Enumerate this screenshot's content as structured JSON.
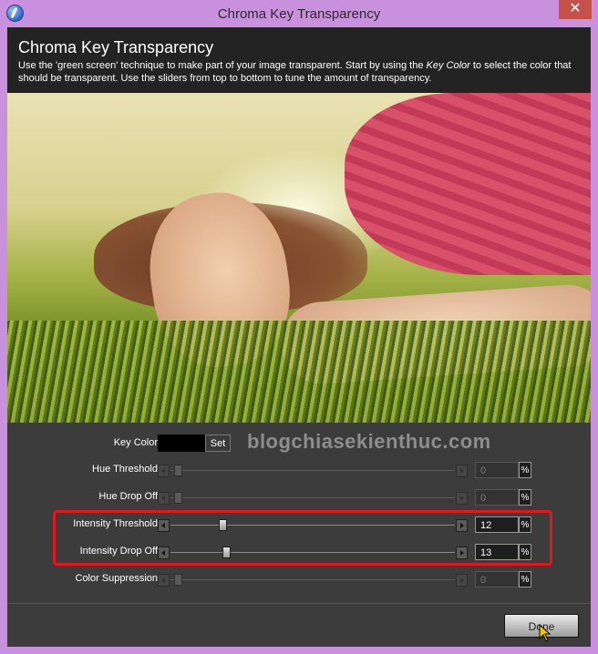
{
  "window": {
    "title": "Chroma Key Transparency",
    "close_glyph": "✕"
  },
  "header": {
    "title": "Chroma Key Transparency",
    "desc_before": "Use the 'green screen' technique to make part of your image transparent. Start by using the ",
    "desc_em": "Key Color",
    "desc_after": " to select the color that should be transparent. Use the sliders from top to bottom to tune the amount of transparency."
  },
  "controls": {
    "key_color": {
      "label": "Key Color",
      "set_label": "Set",
      "swatch_color": "#000000"
    },
    "sliders": [
      {
        "label": "Hue Threshold",
        "value": "0",
        "unit": "%",
        "level": 0,
        "enabled": false
      },
      {
        "label": "Hue Drop Off",
        "value": "0",
        "unit": "%",
        "level": 0,
        "enabled": false
      },
      {
        "label": "Intensity Threshold",
        "value": "12",
        "unit": "%",
        "level": 0.12,
        "enabled": true
      },
      {
        "label": "Intensity Drop Off",
        "value": "13",
        "unit": "%",
        "level": 0.13,
        "enabled": true
      },
      {
        "label": "Color Suppression",
        "value": "0",
        "unit": "%",
        "level": 0,
        "enabled": false
      }
    ]
  },
  "watermark": "blogchiasekienthuc.com",
  "footer": {
    "done_label": "Done"
  },
  "colors": {
    "highlight": "#e2161d",
    "panel": "#3c3c3c",
    "header": "#232323",
    "frame": "#c890dd"
  }
}
